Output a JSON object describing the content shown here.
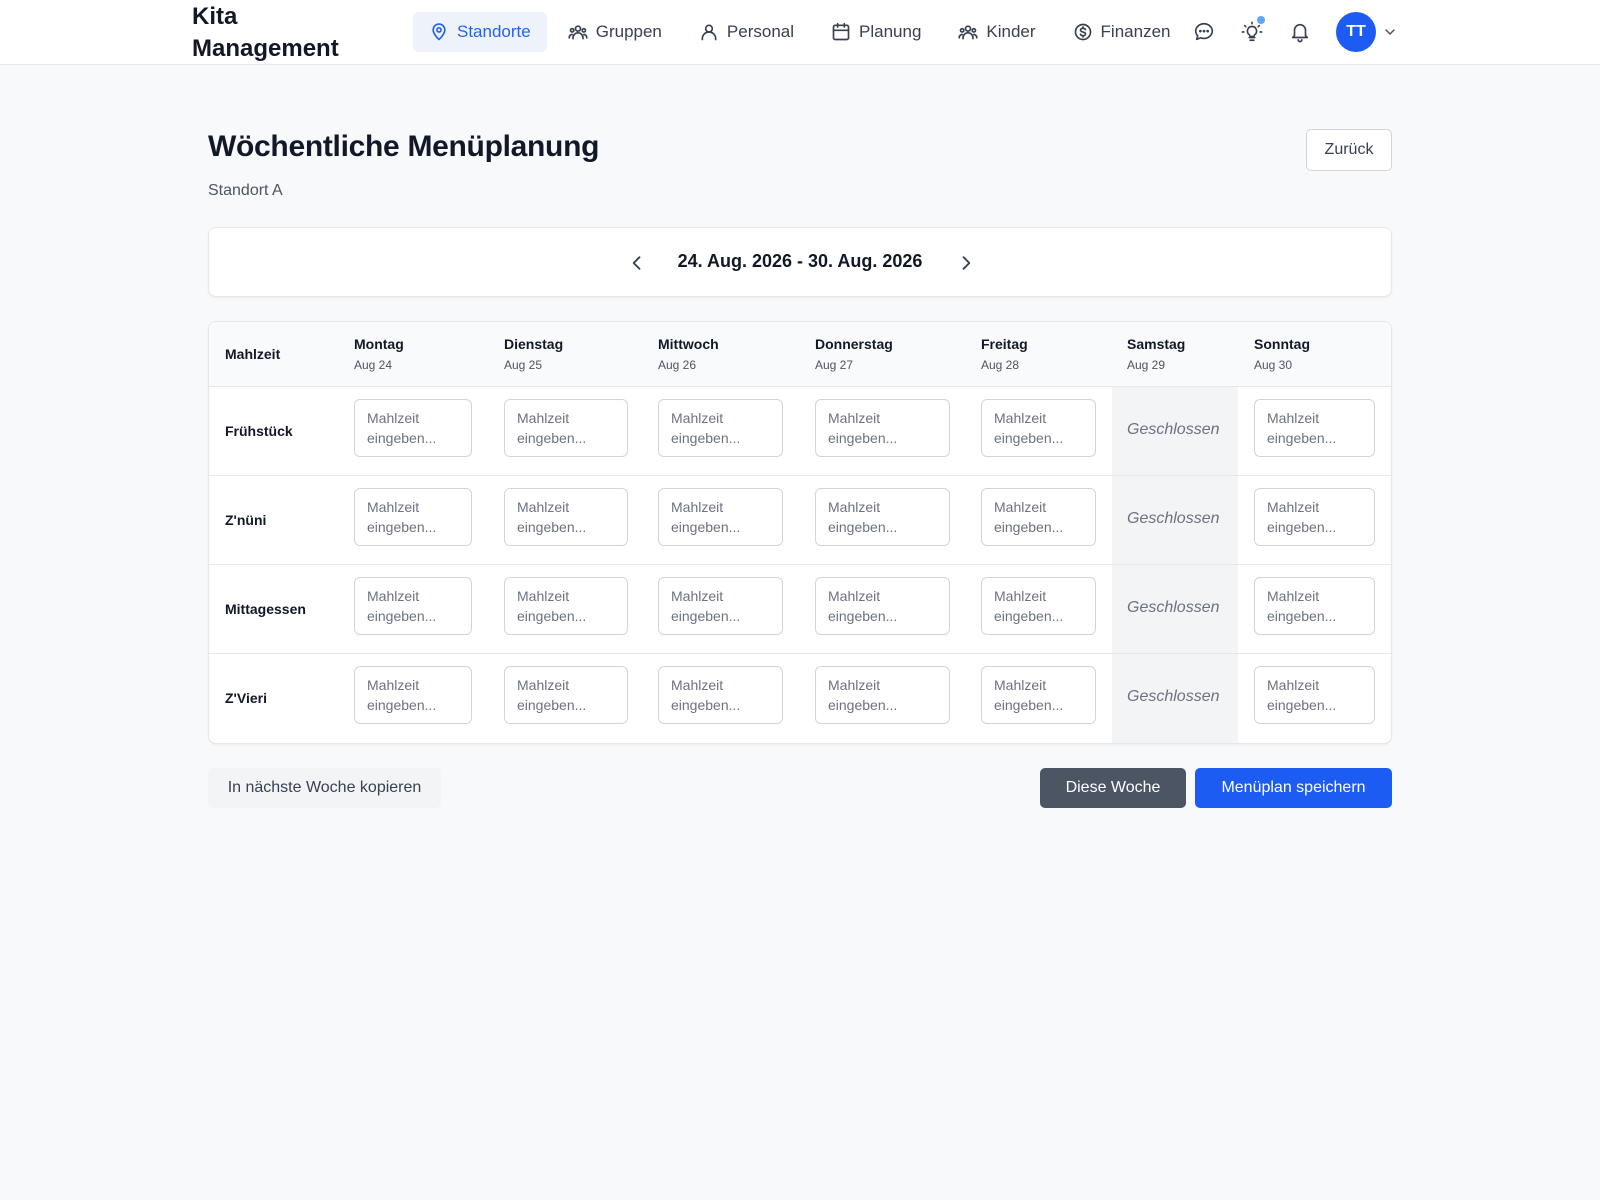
{
  "app": {
    "brand": "Kita Management"
  },
  "nav": {
    "items": [
      {
        "label": "Standorte",
        "icon": "map-pin-icon",
        "active": true
      },
      {
        "label": "Gruppen",
        "icon": "users-icon",
        "active": false
      },
      {
        "label": "Personal",
        "icon": "user-icon",
        "active": false
      },
      {
        "label": "Planung",
        "icon": "calendar-icon",
        "active": false
      },
      {
        "label": "Kinder",
        "icon": "users-icon",
        "active": false
      },
      {
        "label": "Finanzen",
        "icon": "dollar-circle-icon",
        "active": false
      }
    ],
    "icons": [
      "chat-icon",
      "lightbulb-icon",
      "bell-icon"
    ],
    "avatar_initials": "TT"
  },
  "page": {
    "title": "Wöchentliche Menüplanung",
    "subtitle": "Standort A",
    "back_label": "Zurück"
  },
  "week": {
    "range_label": "24. Aug. 2026 - 30. Aug. 2026"
  },
  "table": {
    "meal_header": "Mahlzeit",
    "days": [
      {
        "name": "Montag",
        "date": "Aug 24"
      },
      {
        "name": "Dienstag",
        "date": "Aug 25"
      },
      {
        "name": "Mittwoch",
        "date": "Aug 26"
      },
      {
        "name": "Donnerstag",
        "date": "Aug 27"
      },
      {
        "name": "Freitag",
        "date": "Aug 28"
      },
      {
        "name": "Samstag",
        "date": "Aug 29"
      },
      {
        "name": "Sonntag",
        "date": "Aug 30"
      }
    ],
    "meals": [
      "Frühstück",
      "Z'nüni",
      "Mittagessen",
      "Z'Vieri"
    ],
    "input_placeholder": "Mahlzeit eingeben...",
    "closed_label": "Geschlossen"
  },
  "actions": {
    "copy_label": "In nächste Woche kopieren",
    "this_week_label": "Diese Woche",
    "save_label": "Menüplan speichern"
  },
  "colors": {
    "primary": "#1d5cf2",
    "secondary": "#4b5563",
    "active_nav_bg": "#eef3fb",
    "closed_bg": "#f3f4f6"
  }
}
